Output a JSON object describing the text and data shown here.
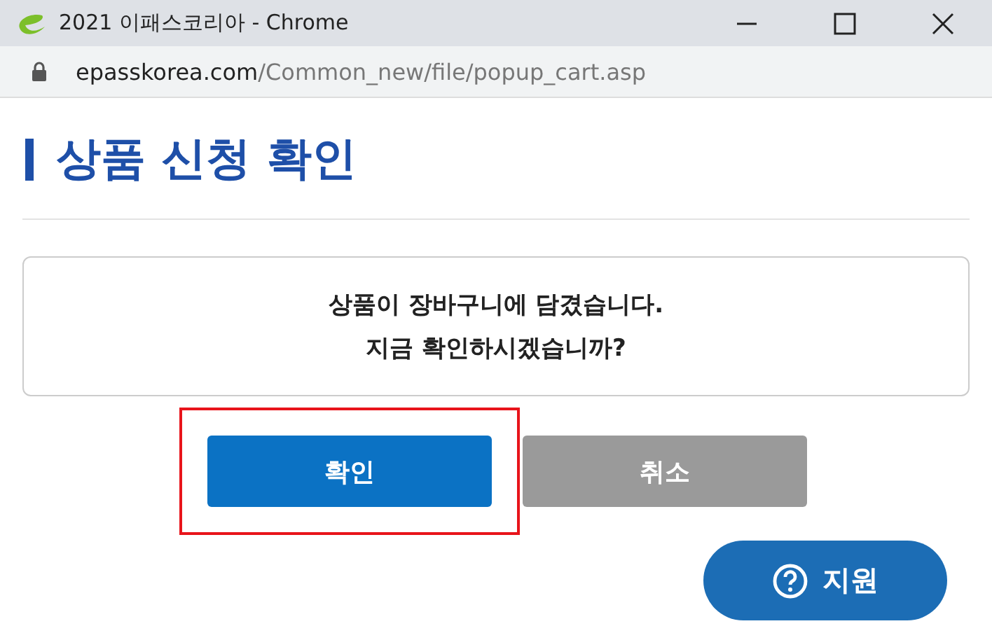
{
  "window": {
    "title": "2021 이패스코리아 - Chrome"
  },
  "address_bar": {
    "domain": "epasskorea.com",
    "path": "/Common_new/file/popup_cart.asp"
  },
  "heading": "상품 신청 확인",
  "message": [
    "상품이 장바구니에 담겼습니다.",
    "지금 확인하시겠습니까?"
  ],
  "buttons": [
    {
      "label": "확인",
      "kind": "primary",
      "highlighted": true
    },
    {
      "label": "취소",
      "kind": "secondary",
      "highlighted": false
    }
  ],
  "support_button": {
    "label": "지원"
  }
}
